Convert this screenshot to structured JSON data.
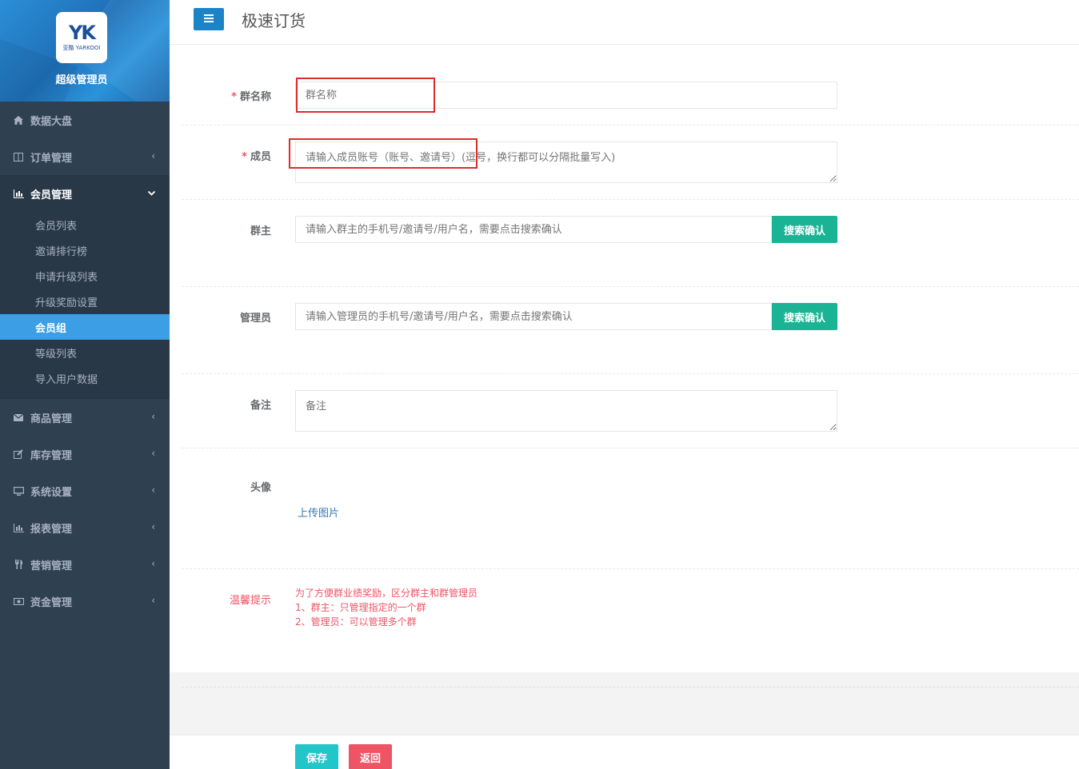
{
  "brand": {
    "logo_mark": "YK",
    "logo_sub": "亚酷 YARKOOI",
    "title": "超级管理员"
  },
  "sidebar": {
    "items": [
      {
        "label": "数据大盘",
        "icon": "home-icon"
      },
      {
        "label": "订单管理",
        "icon": "columns-icon"
      },
      {
        "label": "会员管理",
        "icon": "bar-chart-icon"
      },
      {
        "label": "商品管理",
        "icon": "envelope-icon"
      },
      {
        "label": "库存管理",
        "icon": "edit-icon"
      },
      {
        "label": "系统设置",
        "icon": "desktop-icon"
      },
      {
        "label": "报表管理",
        "icon": "bar-chart-icon"
      },
      {
        "label": "营销管理",
        "icon": "cutlery-icon"
      },
      {
        "label": "资金管理",
        "icon": "money-icon"
      }
    ],
    "submenu": [
      {
        "label": "会员列表"
      },
      {
        "label": "邀请排行榜"
      },
      {
        "label": "申请升级列表"
      },
      {
        "label": "升级奖励设置"
      },
      {
        "label": "会员组"
      },
      {
        "label": "等级列表"
      },
      {
        "label": "导入用户数据"
      }
    ]
  },
  "header": {
    "title": "极速订货"
  },
  "form": {
    "group_name": {
      "required_mark": "*",
      "label": "群名称",
      "placeholder": "群名称"
    },
    "members": {
      "required_mark": "*",
      "label": "成员",
      "placeholder": "请输入成员账号（账号、邀请号）(逗号，换行都可以分隔批量写入)"
    },
    "owner": {
      "label": "群主",
      "placeholder": "请输入群主的手机号/邀请号/用户名，需要点击搜索确认",
      "button": "搜索确认"
    },
    "admin": {
      "label": "管理员",
      "placeholder": "请输入管理员的手机号/邀请号/用户名，需要点击搜索确认",
      "button": "搜索确认"
    },
    "remark": {
      "label": "备注",
      "placeholder": "备注"
    },
    "avatar": {
      "label": "头像",
      "upload": "上传图片"
    },
    "tips": {
      "label": "温馨提示",
      "lines": [
        "为了方便群业绩奖励，区分群主和群管理员",
        "1、群主：只管理指定的一个群",
        "2、管理员：可以管理多个群"
      ]
    }
  },
  "actions": {
    "save": "保存",
    "back": "返回"
  }
}
